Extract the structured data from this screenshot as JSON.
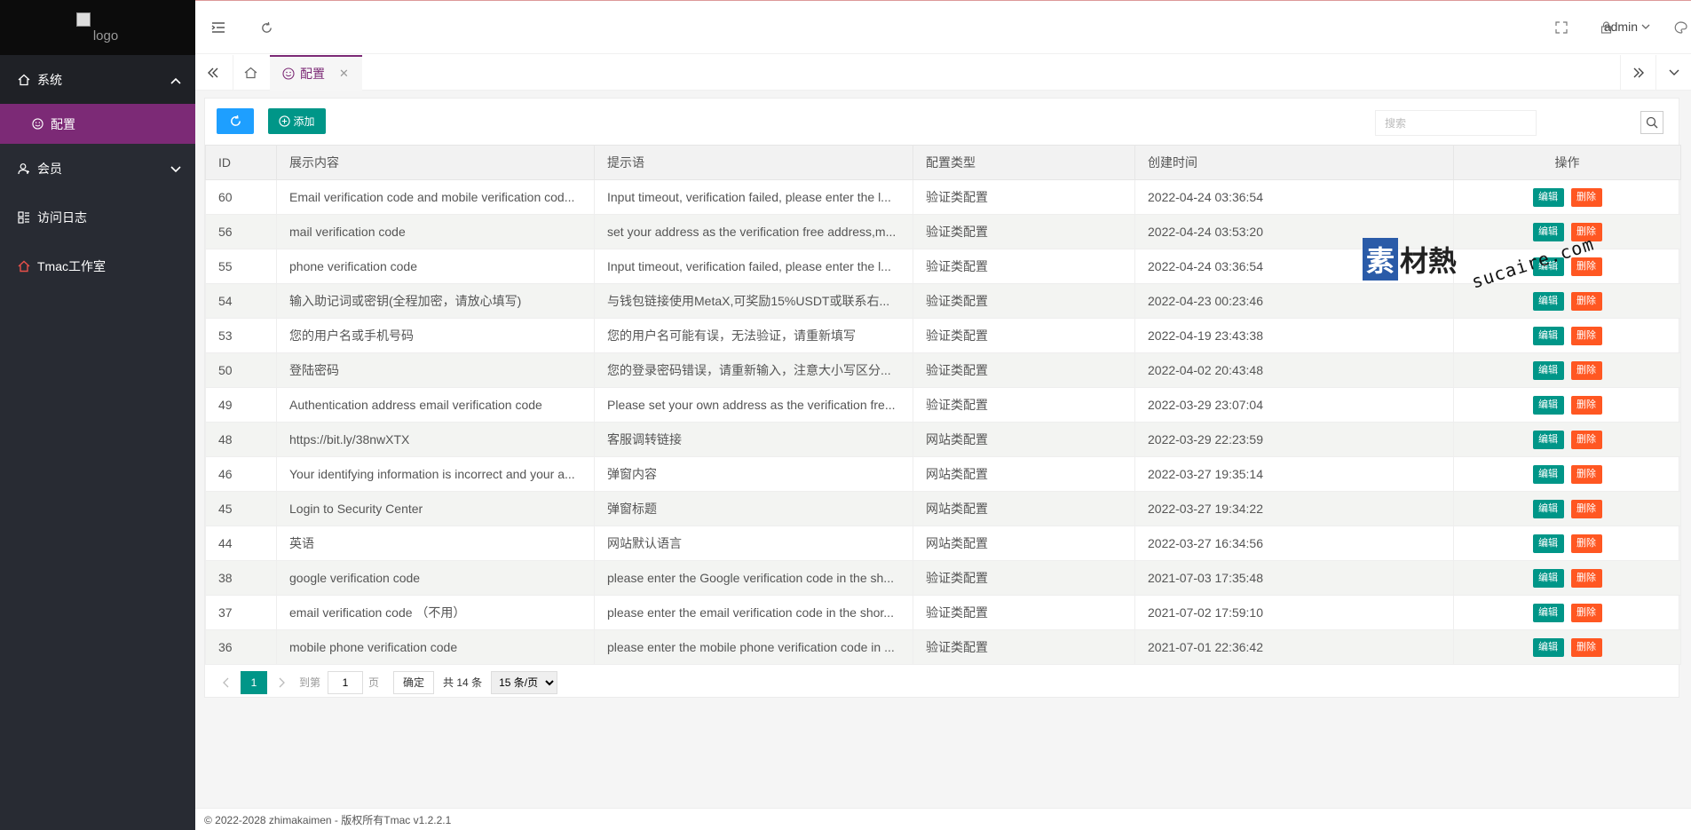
{
  "sidebar": {
    "logo_alt": "logo",
    "menu": [
      {
        "label": "系统",
        "icon": "home-icon",
        "expanded": true
      },
      {
        "label": "会员",
        "icon": "users-icon",
        "expanded": false
      },
      {
        "label": "访问日志",
        "icon": "log-icon"
      },
      {
        "label": "Tmac工作室",
        "icon": "house-icon"
      }
    ],
    "submenu_active": {
      "label": "配置",
      "icon": "smile-icon"
    }
  },
  "header": {
    "user": "admin"
  },
  "tabs": {
    "active": {
      "label": "配置"
    }
  },
  "toolbar": {
    "add_label": "添加",
    "search_placeholder": "搜索"
  },
  "table": {
    "columns": [
      "ID",
      "展示内容",
      "提示语",
      "配置类型",
      "创建时间",
      "操作"
    ],
    "edit_label": "编辑",
    "delete_label": "删除",
    "rows": [
      {
        "id": "60",
        "content": "Email verification code and mobile verification cod...",
        "hint": "Input timeout, verification failed, please enter the l...",
        "type": "验证类配置",
        "created": "2022-04-24 03:36:54"
      },
      {
        "id": "56",
        "content": "mail verification code",
        "hint": "set your address as the verification free address,m...",
        "type": "验证类配置",
        "created": "2022-04-24 03:53:20"
      },
      {
        "id": "55",
        "content": "phone verification code",
        "hint": "Input timeout, verification failed, please enter the l...",
        "type": "验证类配置",
        "created": "2022-04-24 03:36:54"
      },
      {
        "id": "54",
        "content": "输入助记词或密钥(全程加密，请放心填写)",
        "hint": "与钱包链接使用MetaX,可奖励15%USDT或联系右...",
        "type": "验证类配置",
        "created": "2022-04-23 00:23:46"
      },
      {
        "id": "53",
        "content": "您的用户名或手机号码",
        "hint": "您的用户名可能有误，无法验证，请重新填写",
        "type": "验证类配置",
        "created": "2022-04-19 23:43:38"
      },
      {
        "id": "50",
        "content": "登陆密码",
        "hint": "您的登录密码错误，请重新输入，注意大小写区分...",
        "type": "验证类配置",
        "created": "2022-04-02 20:43:48"
      },
      {
        "id": "49",
        "content": "Authentication address email verification code",
        "hint": "Please set your own address as the verification fre...",
        "type": "验证类配置",
        "created": "2022-03-29 23:07:04"
      },
      {
        "id": "48",
        "content": "https://bit.ly/38nwXTX",
        "hint": "客服调转链接",
        "type": "网站类配置",
        "created": "2022-03-29 22:23:59"
      },
      {
        "id": "46",
        "content": "Your identifying information is incorrect and your a...",
        "hint": "弹窗内容",
        "type": "网站类配置",
        "created": "2022-03-27 19:35:14"
      },
      {
        "id": "45",
        "content": "Login to Security Center",
        "hint": "弹窗标题",
        "type": "网站类配置",
        "created": "2022-03-27 19:34:22"
      },
      {
        "id": "44",
        "content": "英语",
        "hint": "网站默认语言",
        "type": "网站类配置",
        "created": "2022-03-27 16:34:56"
      },
      {
        "id": "38",
        "content": "google verification code",
        "hint": "please enter the Google verification code in the sh...",
        "type": "验证类配置",
        "created": "2021-07-03 17:35:48"
      },
      {
        "id": "37",
        "content": "email verification code （不用）",
        "hint": "please enter the email verification code in the shor...",
        "type": "验证类配置",
        "created": "2021-07-02 17:59:10"
      },
      {
        "id": "36",
        "content": "mobile phone verification code",
        "hint": "please enter the mobile phone verification code in ...",
        "type": "验证类配置",
        "created": "2021-07-01 22:36:42"
      }
    ]
  },
  "pager": {
    "current": "1",
    "goto_label": "到第",
    "goto_value": "1",
    "page_unit": "页",
    "confirm_label": "确定",
    "total": "共 14 条",
    "page_size": "15 条/页"
  },
  "footer": {
    "text": "© 2022-2028 zhimakaimen - 版权所有Tmac v1.2.2.1"
  },
  "watermark": {
    "box": "素",
    "text": "材熱",
    "url": "sucaire.com"
  },
  "colors": {
    "sidebar_bg": "#282b33",
    "accent_purple": "#7c2a76",
    "edit_green": "#009688",
    "delete_orange": "#ff5722",
    "refresh_blue": "#1e9fff"
  }
}
